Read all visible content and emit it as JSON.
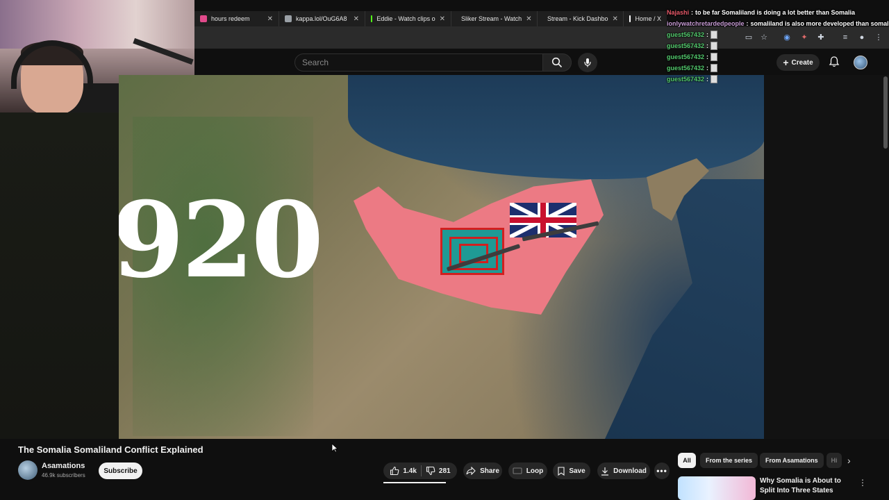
{
  "browser": {
    "tabs": [
      {
        "label": "hours redeem",
        "color": "#e14a8b"
      },
      {
        "label": "kappa.lol/OuG6A8",
        "color": "#9aa0a6"
      },
      {
        "label": "Eddie - Watch clips o",
        "color": "#53fc18"
      },
      {
        "label": "Sliker Stream - Watch",
        "color": "#53fc18"
      },
      {
        "label": "Stream - Kick Dashbo",
        "color": "#53fc18"
      },
      {
        "label": "Home / X",
        "color": "#ffffff"
      }
    ]
  },
  "youtube": {
    "search_placeholder": "Search",
    "create_label": "Create"
  },
  "video": {
    "year_overlay": "920"
  },
  "chat": {
    "lines": [
      {
        "user": "Najashi",
        "user_color": "#e85a6a",
        "message": "to be far Somaliland is doing a lot better than Somalia"
      },
      {
        "user": "ionlywatchretardedpeople",
        "user_color": "#c79bd4",
        "message": "somaliland is also more developed than somalia"
      },
      {
        "user": "guest567432",
        "user_color": "#53c96d",
        "message": ""
      },
      {
        "user": "guest567432",
        "user_color": "#53c96d",
        "message": ""
      },
      {
        "user": "guest567432",
        "user_color": "#53c96d",
        "message": ""
      },
      {
        "user": "guest567432",
        "user_color": "#53c96d",
        "message": ""
      },
      {
        "user": "guest567432",
        "user_color": "#53c96d",
        "message": ""
      }
    ]
  },
  "watch": {
    "title": "The Somalia Somaliland Conflict Explained",
    "channel_name": "Asamations",
    "subscribers": "46.9k subscribers",
    "subscribe_label": "Subscribe",
    "like_count": "1.4k",
    "dislike_count": "281",
    "share_label": "Share",
    "loop_label": "Loop",
    "save_label": "Save",
    "download_label": "Download"
  },
  "sidebar": {
    "chips": {
      "all": "All",
      "series": "From the series",
      "from_channel": "From Asamations",
      "more": "Hi"
    },
    "recommendation_title": "Why Somalia is About to Split Into Three States"
  }
}
